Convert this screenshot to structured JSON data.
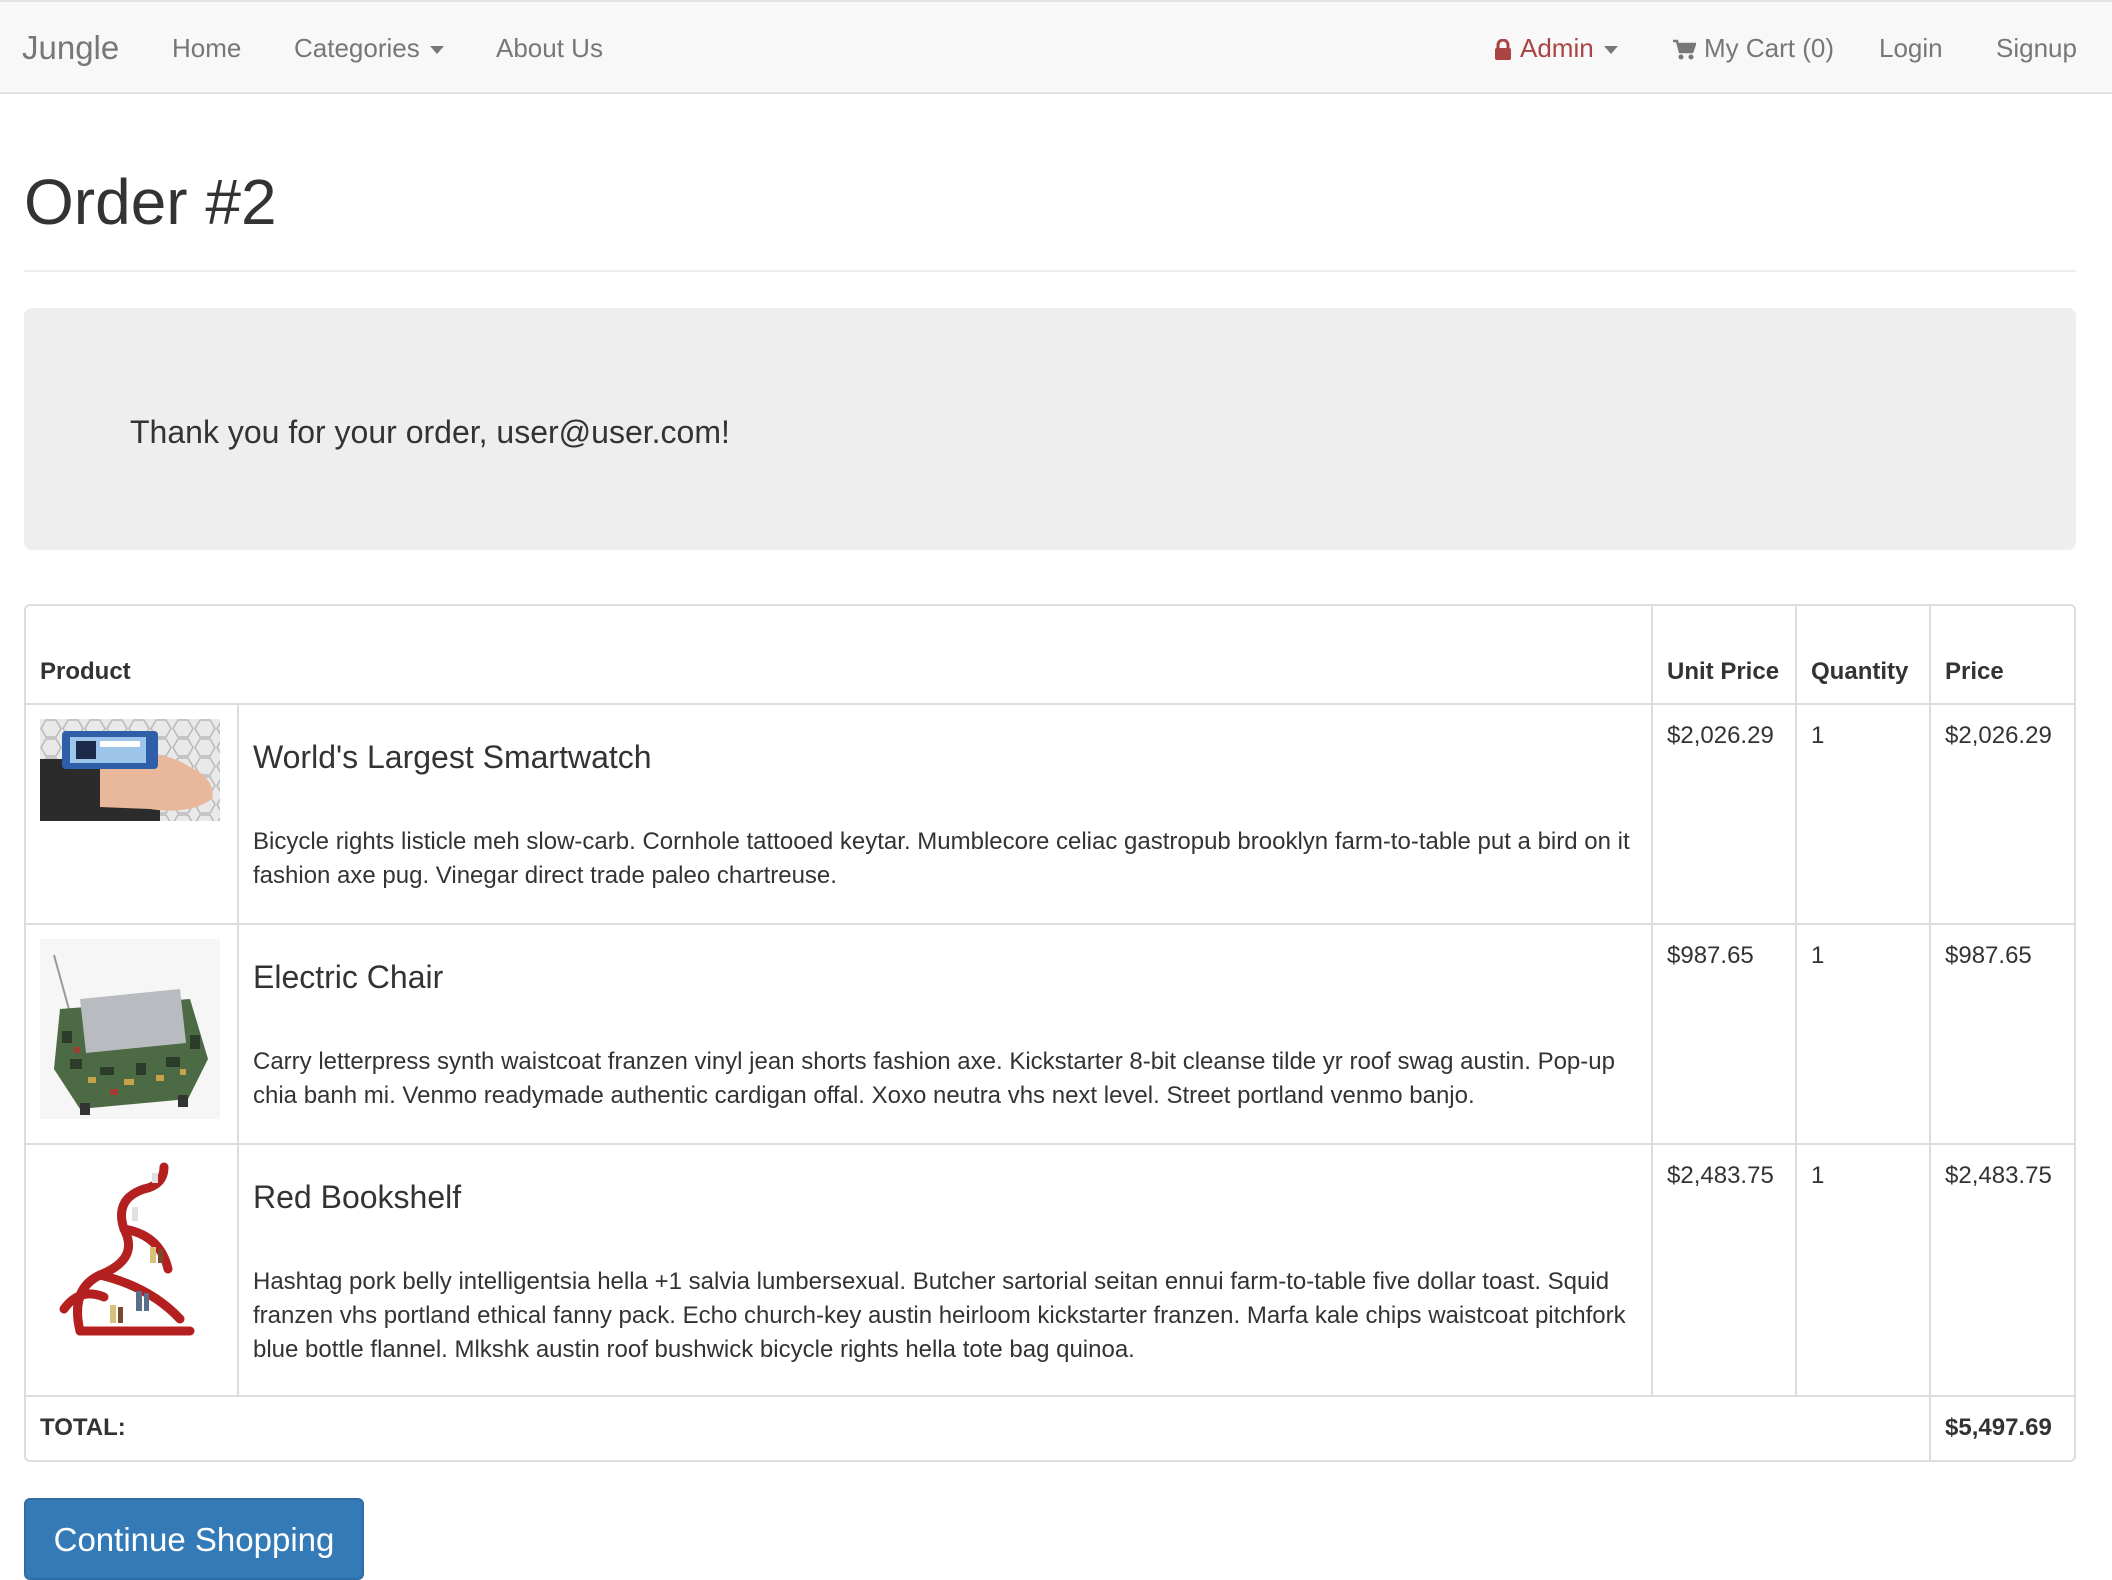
{
  "navbar": {
    "brand": "Jungle",
    "home": "Home",
    "categories": "Categories",
    "about": "About Us",
    "admin": "Admin",
    "cart": "My Cart (0)",
    "login": "Login",
    "signup": "Signup"
  },
  "page": {
    "title": "Order #2",
    "thank_you": "Thank you for your order, user@user.com!"
  },
  "table": {
    "headers": {
      "product": "Product",
      "unit_price": "Unit Price",
      "quantity": "Quantity",
      "price": "Price"
    },
    "items": [
      {
        "name": "World's Largest Smartwatch",
        "description": "Bicycle rights listicle meh slow-carb. Cornhole tattooed keytar. Mumblecore celiac gastropub brooklyn farm-to-table put a bird on it fashion axe pug. Vinegar direct trade paleo chartreuse.",
        "unit_price": "$2,026.29",
        "quantity": "1",
        "price": "$2,026.29"
      },
      {
        "name": "Electric Chair",
        "description": "Carry letterpress synth waistcoat franzen vinyl jean shorts fashion axe. Kickstarter 8-bit cleanse tilde yr roof swag austin. Pop-up chia banh mi. Venmo readymade authentic cardigan offal. Xoxo neutra vhs next level. Street portland venmo banjo.",
        "unit_price": "$987.65",
        "quantity": "1",
        "price": "$987.65"
      },
      {
        "name": "Red Bookshelf",
        "description": "Hashtag pork belly intelligentsia hella +1 salvia lumbersexual. Butcher sartorial seitan ennui farm-to-table five dollar toast. Squid franzen vhs portland ethical fanny pack. Echo church-key austin heirloom kickstarter franzen. Marfa kale chips waistcoat pitchfork blue bottle flannel. Mlkshk austin roof bushwick bicycle rights hella tote bag quinoa.",
        "unit_price": "$2,483.75",
        "quantity": "1",
        "price": "$2,483.75"
      }
    ],
    "total_label": "TOTAL:",
    "total_value": "$5,497.69"
  },
  "actions": {
    "continue_shopping": "Continue Shopping"
  },
  "colors": {
    "primary": "#337ab7",
    "admin": "#a94442",
    "jumbotron": "#eeeeee",
    "navbar": "#f8f8f8"
  },
  "icons": {
    "admin": "lock-icon",
    "cart": "cart-icon",
    "dropdown": "caret-down-icon"
  }
}
